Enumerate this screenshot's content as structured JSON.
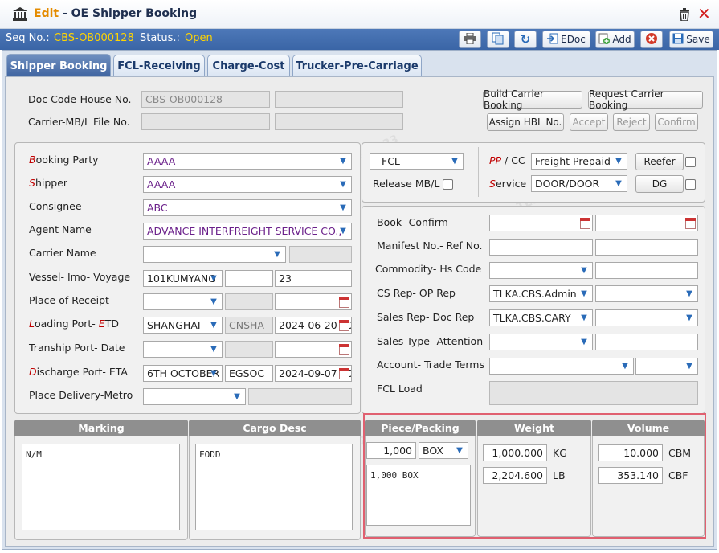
{
  "window": {
    "title_prefix": "Edit",
    "title_sep": " - ",
    "title_main": "OE Shipper Booking"
  },
  "status": {
    "seq_label": "Seq No.:",
    "seq_value": "CBS-OB000128",
    "status_label": "Status.:",
    "status_value": "Open"
  },
  "toolbar": {
    "edoc_label": "EDoc",
    "add_label": "Add",
    "save_label": "Save"
  },
  "tabs": [
    {
      "label": "Shipper Booking"
    },
    {
      "label": "FCL-Receiving"
    },
    {
      "label": "Charge-Cost"
    },
    {
      "label": "Trucker-Pre-Carriage"
    }
  ],
  "doc": {
    "doc_code_label": "Doc Code-House No.",
    "doc_code_value": "CBS-OB000128",
    "carrier_mbl_label": "Carrier-MB/L File No.",
    "build_carrier_booking": "Build Carrier Booking",
    "request_carrier_booking": "Request Carrier Booking",
    "assign_hbl": "Assign HBL No.",
    "accept": "Accept",
    "reject": "Reject",
    "confirm": "Confirm"
  },
  "parties": {
    "booking_party": {
      "label_first": "B",
      "label_rest": "ooking Party",
      "value": "AAAA"
    },
    "shipper": {
      "label_first": "S",
      "label_rest": "hipper",
      "value": "AAAA"
    },
    "consignee": {
      "label": "Consignee",
      "value": "ABC"
    },
    "agent_name": {
      "label": "Agent Name",
      "value": "ADVANCE INTERFREIGHT SERVICE CO.,"
    },
    "carrier_name": {
      "label": "Carrier Name"
    },
    "vessel": {
      "label": "Vessel- Imo- Voyage",
      "vessel_value": "101KUMYANG",
      "voyage_value": "23"
    },
    "place_receipt": {
      "label": "Place of Receipt"
    },
    "loading_port": {
      "label_l": "L",
      "label_mid": "oading Port- ",
      "label_e": "E",
      "label_end": "TD",
      "value": "SHANGHAI",
      "code": "CNSHA",
      "date": "2024-06-20 00:00"
    },
    "tranship_port": {
      "label": "Tranship Port- Date"
    },
    "discharge_port": {
      "label_d": "D",
      "label_mid": "ischarge Port- ETA",
      "value": "6TH OCTOBER",
      "code": "EGSOC",
      "date": "2024-09-07 00:00"
    },
    "place_delivery": {
      "label": "Place Delivery-Metro"
    }
  },
  "right": {
    "load_type": "FCL",
    "release_mbl_label": "Release MB/L",
    "ppcc_label_p": "PP",
    "ppcc_label_sep": " / ",
    "ppcc_label_cc": "CC",
    "ppcc_value": "Freight Prepaid",
    "service_label_s": "S",
    "service_label_rest": "ervice",
    "service_value": "DOOR/DOOR",
    "reefer_label": "Reefer",
    "dg_label": "DG",
    "book_confirm_label": "Book- Confirm",
    "manifest_label": "Manifest No.- Ref No.",
    "commodity_label": "Commodity- Hs Code",
    "cs_rep_label": "CS Rep- OP Rep",
    "cs_rep_value": "TLKA.CBS.Admin",
    "sales_rep_label": "Sales Rep- Doc Rep",
    "sales_rep_value": "TLKA.CBS.CARY",
    "sales_type_label": "Sales Type- Attention",
    "account_label": "Account- Trade Terms",
    "fcl_load_label": "FCL Load"
  },
  "cargo": {
    "marking_header": "Marking",
    "marking_text": "N/M",
    "cargo_desc_header": "Cargo Desc",
    "cargo_desc_text": "FODD",
    "piece_header": "Piece/Packing",
    "piece_count": "1,000",
    "piece_unit": "BOX",
    "piece_text": "1,000 BOX",
    "weight_header": "Weight",
    "weight_kg": "1,000.000",
    "weight_kg_unit": "KG",
    "weight_lb": "2,204.600",
    "weight_lb_unit": "LB",
    "volume_header": "Volume",
    "volume_cbm": "10.000",
    "volume_cbm_unit": "CBM",
    "volume_cbf": "353.140",
    "volume_cbf_unit": "CBF"
  },
  "watermark": "TLKA.CBS.TEST 2024-08-23",
  "colors": {
    "status_bar": "#3a65a6",
    "status_value": "#ffd400",
    "required_label": "#c00000",
    "highlight_border": "#e06070"
  }
}
